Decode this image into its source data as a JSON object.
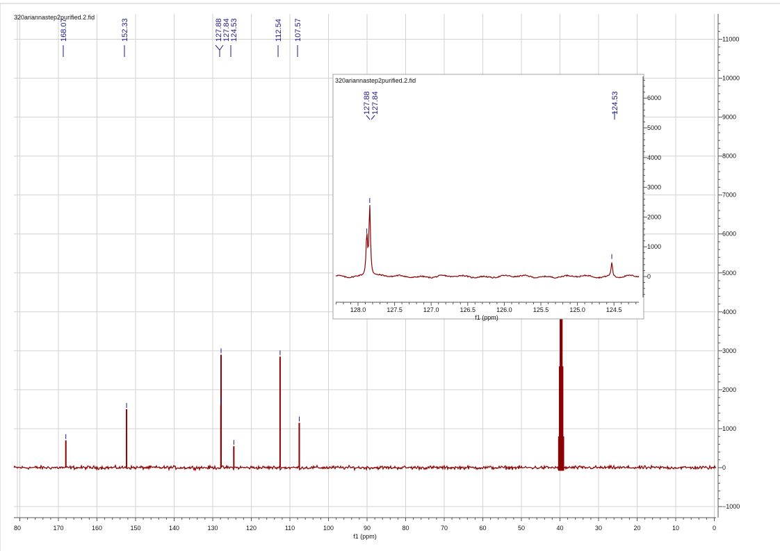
{
  "chart_data": [
    {
      "type": "line",
      "title": "320ariannastep2purified.2.fid",
      "xlabel": "f1 (ppm)",
      "ylabel": "",
      "xlim": [
        80,
        0
      ],
      "ylim": [
        -1300,
        11600
      ],
      "x_ticks": [
        80,
        170,
        160,
        150,
        140,
        130,
        120,
        110,
        100,
        90,
        80,
        70,
        60,
        50,
        40,
        30,
        20,
        10,
        0
      ],
      "x_tick_labels": [
        "80",
        "170",
        "160",
        "150",
        "140",
        "130",
        "120",
        "110",
        "100",
        "90",
        "80",
        "70",
        "60",
        "50",
        "40",
        "30",
        "20",
        "10",
        "0"
      ],
      "y_ticks": [
        -1000,
        0,
        1000,
        2000,
        3000,
        4000,
        5000,
        6000,
        7000,
        8000,
        9000,
        10000,
        11000
      ],
      "grid": true,
      "peak_labels": [
        "168.07",
        "152.33",
        "127.88",
        "127.84",
        "124.53",
        "112.54",
        "107.57"
      ],
      "peaks": [
        {
          "ppm": 168.07,
          "height": 700
        },
        {
          "ppm": 152.33,
          "height": 1500
        },
        {
          "ppm": 127.88,
          "height": 1600
        },
        {
          "ppm": 127.84,
          "height": 2900
        },
        {
          "ppm": 124.53,
          "height": 550
        },
        {
          "ppm": 112.54,
          "height": 2850
        },
        {
          "ppm": 107.57,
          "height": 1150
        }
      ],
      "solvent_peaks": [
        {
          "ppm": 40.3,
          "height": 800
        },
        {
          "ppm": 40.1,
          "height": 2600
        },
        {
          "ppm": 39.9,
          "height": 4500
        },
        {
          "ppm": 39.7,
          "height": 4500
        },
        {
          "ppm": 39.5,
          "height": 4500
        },
        {
          "ppm": 39.3,
          "height": 2600
        },
        {
          "ppm": 39.1,
          "height": 800
        }
      ],
      "line_color": "#8b0000",
      "marker_color": "#1a1a8a"
    },
    {
      "type": "line",
      "title": "320ariannastep2purified.2.fid",
      "xlabel": "f1 (ppm)",
      "ylabel": "",
      "xlim": [
        128.35,
        124.2
      ],
      "ylim": [
        -750,
        6650
      ],
      "x_ticks": [
        128.0,
        127.5,
        127.0,
        126.5,
        126.0,
        125.5,
        125.0,
        124.5
      ],
      "x_tick_labels": [
        "128.0",
        "127.5",
        "127.0",
        "126.5",
        "126.0",
        "125.5",
        "125.0",
        "124.5"
      ],
      "y_ticks": [
        0,
        1000,
        2000,
        3000,
        4000,
        5000,
        6000
      ],
      "grid": false,
      "peak_labels": [
        "127.88",
        "127.84",
        "124.53"
      ],
      "peaks": [
        {
          "ppm": 127.88,
          "height": 1650
        },
        {
          "ppm": 127.84,
          "height": 2900
        },
        {
          "ppm": 124.53,
          "height": 600
        }
      ],
      "line_color": "#8b0000",
      "marker_color": "#1a1a8a"
    }
  ]
}
